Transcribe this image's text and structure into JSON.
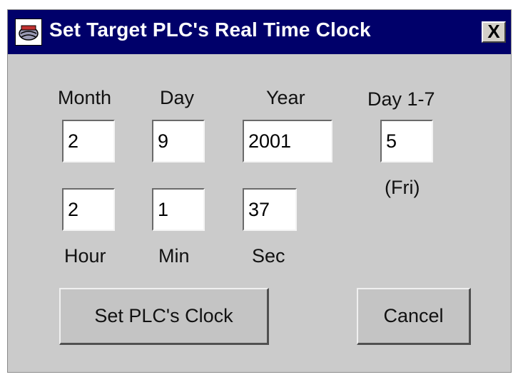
{
  "window": {
    "title": "Set Target PLC's Real Time Clock",
    "icon": "plc-app-icon",
    "close_label": "X"
  },
  "date": {
    "month_label": "Month",
    "month_value": "2",
    "day_label": "Day",
    "day_value": "9",
    "year_label": "Year",
    "year_value": "2001",
    "weekday_label": "Day 1-7",
    "weekday_value": "5",
    "weekday_name": "(Fri)"
  },
  "time": {
    "hour_label": "Hour",
    "hour_value": "2",
    "min_label": "Min",
    "min_value": "1",
    "sec_label": "Sec",
    "sec_value": "37"
  },
  "buttons": {
    "set_label": "Set PLC's Clock",
    "cancel_label": "Cancel"
  },
  "colors": {
    "titlebar": "#00006a",
    "dialog_bg": "#cbcbcb",
    "button_bg": "#c4c4c4"
  }
}
